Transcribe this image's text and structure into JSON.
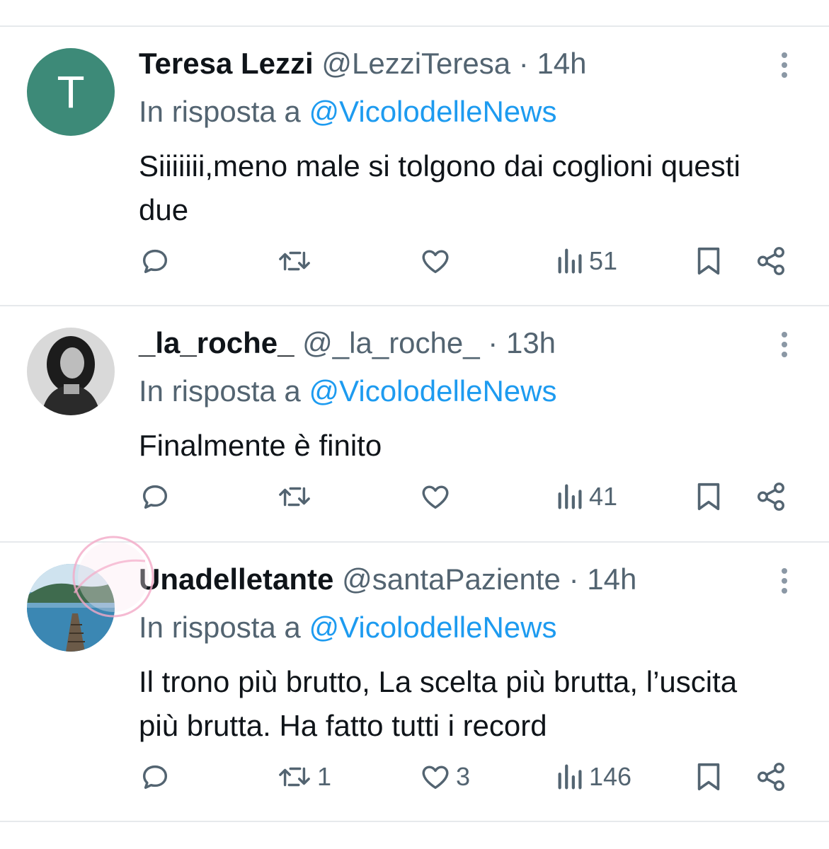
{
  "colors": {
    "accent": "#1d9bf0",
    "secondary_text": "#536471",
    "primary_text": "#0f1419",
    "avatar_T": "#3d8a78"
  },
  "reply_prefix": "In risposta a",
  "tweets": [
    {
      "avatar_letter": "T",
      "name": "Teresa Lezzi",
      "handle": "@LezziTeresa",
      "sep": "·",
      "time": "14h",
      "reply_to": "@VicolodelleNews",
      "text": "Siiiiiii,meno male si tolgono dai coglioni questi due",
      "reply_count": "",
      "retweet_count": "",
      "like_count": "",
      "views": "51"
    },
    {
      "avatar_letter": "",
      "name": "_la_roche_",
      "handle": "@_la_roche_",
      "sep": "·",
      "time": "13h",
      "reply_to": "@VicolodelleNews",
      "text": "Finalmente è finito",
      "reply_count": "",
      "retweet_count": "",
      "like_count": "",
      "views": "41"
    },
    {
      "avatar_letter": "",
      "name": "Unadelletante",
      "handle": "@santaPaziente",
      "sep": "·",
      "time": "14h",
      "reply_to": "@VicolodelleNews",
      "text": "Il trono più brutto, La scelta più brutta, l’uscita più brutta. Ha fatto tutti i record",
      "reply_count": "",
      "retweet_count": "1",
      "like_count": "3",
      "views": "146"
    }
  ],
  "icons": [
    "reply-icon",
    "retweet-icon",
    "like-icon",
    "views-icon",
    "bookmark-icon",
    "share-icon",
    "more-icon"
  ]
}
